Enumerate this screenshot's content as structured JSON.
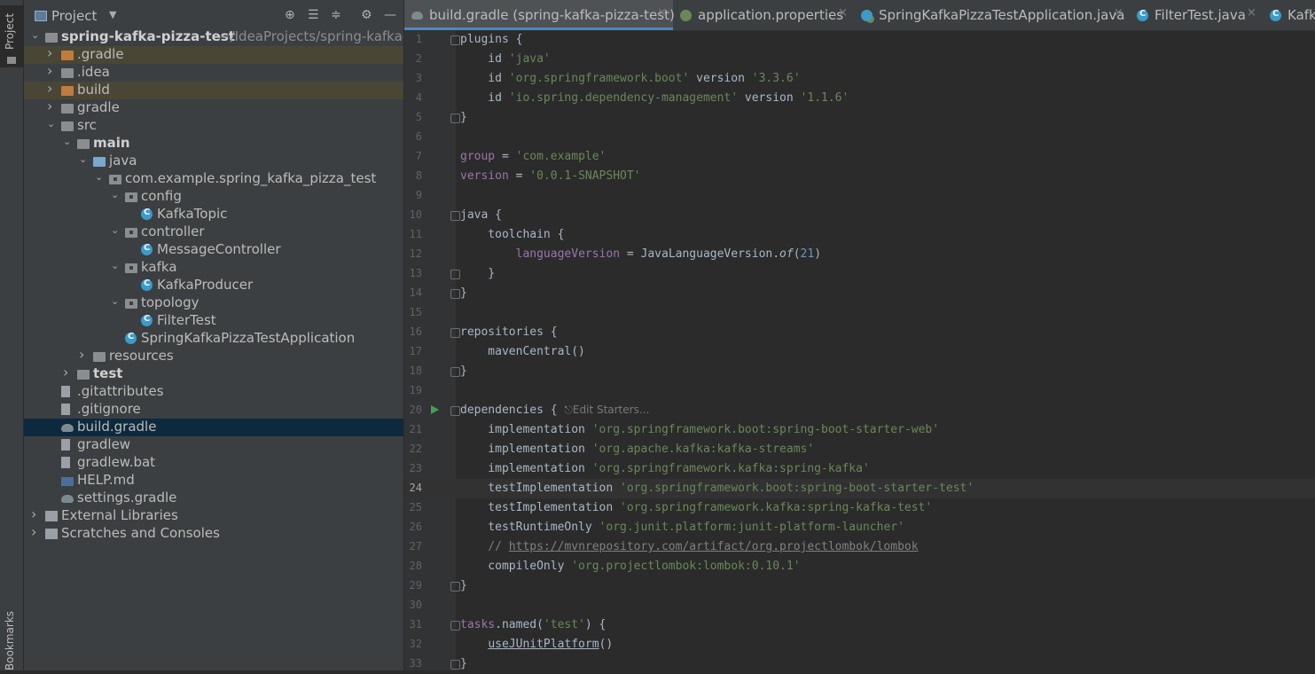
{
  "sidebar_strip": {
    "project_tab": "Project",
    "bookmarks_tab": "Bookmarks"
  },
  "project_panel": {
    "title": "Project",
    "tree": [
      {
        "label": "spring-kafka-pizza-test",
        "suffix": "~/IdeaProjects/spring-kafka-p",
        "depth": 0,
        "arrow": "open",
        "icon": "folder-icon"
      },
      {
        "label": ".gradle",
        "depth": 1,
        "arrow": "closed",
        "icon": "folder-icon",
        "excluded": true
      },
      {
        "label": ".idea",
        "depth": 1,
        "arrow": "closed",
        "icon": "folder-icon"
      },
      {
        "label": "build",
        "depth": 1,
        "arrow": "closed",
        "icon": "folder-icon",
        "excluded": true
      },
      {
        "label": "gradle",
        "depth": 1,
        "arrow": "closed",
        "icon": "folder-icon"
      },
      {
        "label": "src",
        "depth": 1,
        "arrow": "open",
        "icon": "folder-icon"
      },
      {
        "label": "main",
        "depth": 2,
        "arrow": "open",
        "icon": "folder-icon",
        "bold": true
      },
      {
        "label": "java",
        "depth": 3,
        "arrow": "open",
        "icon": "source-folder-icon"
      },
      {
        "label": "com.example.spring_kafka_pizza_test",
        "depth": 4,
        "arrow": "open",
        "icon": "package-icon"
      },
      {
        "label": "config",
        "depth": 5,
        "arrow": "open",
        "icon": "package-icon"
      },
      {
        "label": "KafkaTopic",
        "depth": 6,
        "icon": "class-icon"
      },
      {
        "label": "controller",
        "depth": 5,
        "arrow": "open",
        "icon": "package-icon"
      },
      {
        "label": "MessageController",
        "depth": 6,
        "icon": "class-icon"
      },
      {
        "label": "kafka",
        "depth": 5,
        "arrow": "open",
        "icon": "package-icon"
      },
      {
        "label": "KafkaProducer",
        "depth": 6,
        "icon": "class-icon"
      },
      {
        "label": "topology",
        "depth": 5,
        "arrow": "open",
        "icon": "package-icon"
      },
      {
        "label": "FilterTest",
        "depth": 6,
        "icon": "class-icon"
      },
      {
        "label": "SpringKafkaPizzaTestApplication",
        "depth": 5,
        "icon": "spring-class-icon"
      },
      {
        "label": "resources",
        "depth": 3,
        "arrow": "closed",
        "icon": "resources-folder-icon"
      },
      {
        "label": "test",
        "depth": 2,
        "arrow": "closed",
        "icon": "folder-icon",
        "bold": true
      },
      {
        "label": ".gitattributes",
        "depth": 1,
        "icon": "file-icon"
      },
      {
        "label": ".gitignore",
        "depth": 1,
        "icon": "file-icon"
      },
      {
        "label": "build.gradle",
        "depth": 1,
        "icon": "gradle-icon",
        "selected": true
      },
      {
        "label": "gradlew",
        "depth": 1,
        "icon": "file-icon"
      },
      {
        "label": "gradlew.bat",
        "depth": 1,
        "icon": "file-icon"
      },
      {
        "label": "HELP.md",
        "depth": 1,
        "icon": "markdown-icon"
      },
      {
        "label": "settings.gradle",
        "depth": 1,
        "icon": "gradle-icon"
      },
      {
        "label": "External Libraries",
        "depth": 0,
        "arrow": "closed",
        "icon": "library-icon"
      },
      {
        "label": "Scratches and Consoles",
        "depth": 0,
        "arrow": "closed",
        "icon": "scratches-icon"
      }
    ]
  },
  "tabs": [
    {
      "label": "build.gradle (spring-kafka-pizza-test)",
      "icon": "gradle-icon",
      "active": true
    },
    {
      "label": "application.properties",
      "icon": "properties-icon"
    },
    {
      "label": "SpringKafkaPizzaTestApplication.java",
      "icon": "spring-class-icon"
    },
    {
      "label": "FilterTest.java",
      "icon": "class-icon"
    },
    {
      "label": "Kafk",
      "icon": "class-icon"
    }
  ],
  "editor": {
    "current_line": 24,
    "hint_text": "Edit Starters...",
    "lines": [
      [
        {
          "t": "plugins {"
        }
      ],
      [
        {
          "t": "    id "
        },
        {
          "t": "'java'",
          "c": "s"
        }
      ],
      [
        {
          "t": "    id "
        },
        {
          "t": "'org.springframework.boot'",
          "c": "s"
        },
        {
          "t": " version "
        },
        {
          "t": "'3.3.6'",
          "c": "s"
        }
      ],
      [
        {
          "t": "    id "
        },
        {
          "t": "'io.spring.dependency-management'",
          "c": "s"
        },
        {
          "t": " version "
        },
        {
          "t": "'1.1.6'",
          "c": "s"
        }
      ],
      [
        {
          "t": "}"
        }
      ],
      [],
      [
        {
          "t": "group",
          "c": "p"
        },
        {
          "t": " = "
        },
        {
          "t": "'com.example'",
          "c": "s"
        }
      ],
      [
        {
          "t": "version",
          "c": "p"
        },
        {
          "t": " = "
        },
        {
          "t": "'0.0.1-SNAPSHOT'",
          "c": "s"
        }
      ],
      [],
      [
        {
          "t": "java {"
        }
      ],
      [
        {
          "t": "    toolchain {"
        }
      ],
      [
        {
          "t": "        "
        },
        {
          "t": "languageVersion",
          "c": "p"
        },
        {
          "t": " = JavaLanguageVersion."
        },
        {
          "t": "of",
          "c": "it"
        },
        {
          "t": "("
        },
        {
          "t": "21",
          "c": "n"
        },
        {
          "t": ")"
        }
      ],
      [
        {
          "t": "    }"
        }
      ],
      [
        {
          "t": "}"
        }
      ],
      [],
      [
        {
          "t": "repositories {"
        }
      ],
      [
        {
          "t": "    mavenCentral()"
        }
      ],
      [
        {
          "t": "}"
        }
      ],
      [],
      [
        {
          "t": "dependencies { "
        },
        {
          "t": "⎋Edit Starters...",
          "c": "hint"
        }
      ],
      [
        {
          "t": "    implementation "
        },
        {
          "t": "'org.springframework.boot:spring-boot-starter-web'",
          "c": "s"
        }
      ],
      [
        {
          "t": "    implementation "
        },
        {
          "t": "'org.apache.kafka:kafka-streams'",
          "c": "s"
        }
      ],
      [
        {
          "t": "    implementation "
        },
        {
          "t": "'org.springframework.kafka:spring-kafka'",
          "c": "s"
        }
      ],
      [
        {
          "t": "    testImplementation "
        },
        {
          "t": "'org.springframework.boot:spring-boot-starter-test'",
          "c": "s"
        }
      ],
      [
        {
          "t": "    testImplementation "
        },
        {
          "t": "'org.springframework.kafka:spring-kafka-test'",
          "c": "s"
        }
      ],
      [
        {
          "t": "    testRuntimeOnly "
        },
        {
          "t": "'org.junit.platform:junit-platform-launcher'",
          "c": "s"
        }
      ],
      [
        {
          "t": "    // ",
          "c": "cm"
        },
        {
          "t": "https://mvnrepository.com/artifact/org.projectlombok/lombok",
          "c": "url"
        }
      ],
      [
        {
          "t": "    compileOnly "
        },
        {
          "t": "'org.projectlombok:lombok:0.10.1'",
          "c": "s"
        }
      ],
      [
        {
          "t": "}"
        }
      ],
      [],
      [
        {
          "t": "tasks",
          "c": "p"
        },
        {
          "t": ".named("
        },
        {
          "t": "'test'",
          "c": "s"
        },
        {
          "t": ") {"
        }
      ],
      [
        {
          "t": "    "
        },
        {
          "t": "useJUnitPlatform",
          "c": "ul"
        },
        {
          "t": "()"
        }
      ],
      [
        {
          "t": "}"
        }
      ]
    ],
    "fold_lines": [
      1,
      5,
      10,
      13,
      14,
      16,
      18,
      20,
      29,
      31,
      33
    ],
    "run_lines": [
      20
    ]
  }
}
